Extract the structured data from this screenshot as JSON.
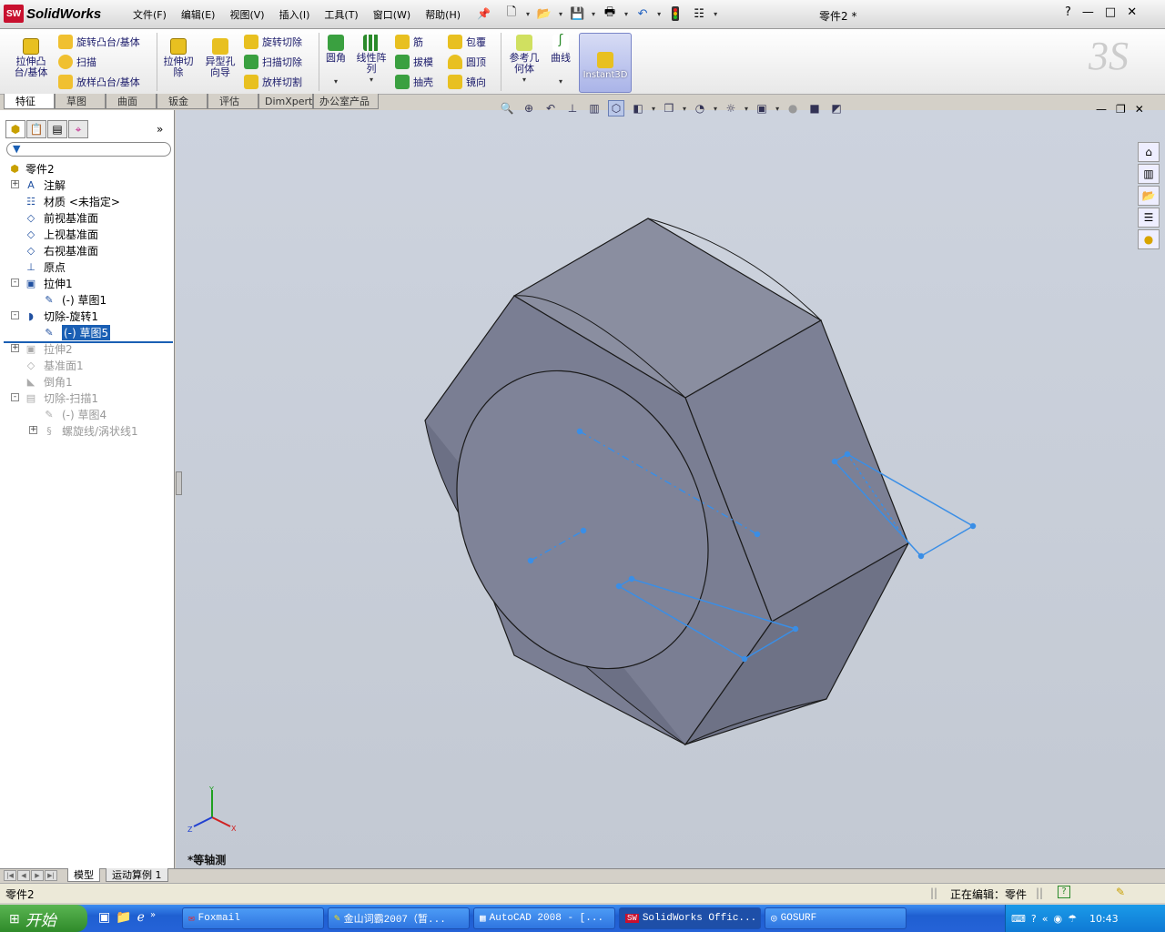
{
  "app": {
    "name": "SolidWorks",
    "document_title": "零件2 *",
    "logo_text": "SW"
  },
  "menus": [
    "文件(F)",
    "编辑(E)",
    "视图(V)",
    "插入(I)",
    "工具(T)",
    "窗口(W)",
    "帮助(H)"
  ],
  "quick_access": [
    "new-icon",
    "open-icon",
    "save-icon",
    "print-icon",
    "undo-icon",
    "rebuild-icon",
    "options-icon"
  ],
  "window_controls": [
    "?",
    "—",
    "□",
    "✕"
  ],
  "ribbon": {
    "extrude_boss": "拉伸凸\n台/基体",
    "revolve_boss": "旋转凸台/基体",
    "sweep": "扫描",
    "loft": "放样凸台/基体",
    "extrude_cut": "拉伸切\n除",
    "hole_wizard": "异型孔\n向导",
    "revolve_cut": "旋转切除",
    "sweep_cut": "扫描切除",
    "loft_cut": "放样切割",
    "fillet": "圆角",
    "linear_pattern": "线性阵\n列",
    "rib": "筋",
    "draft": "拔模",
    "shell": "抽壳",
    "wrap": "包覆",
    "dome": "圆顶",
    "mirror": "镜向",
    "ref_geometry": "参考几\n何体",
    "curves": "曲线",
    "instant3d": "Instant3D"
  },
  "command_tabs": [
    "特征",
    "草图",
    "曲面",
    "钣金",
    "评估",
    "DimXpert",
    "办公室产品"
  ],
  "tree": {
    "root": "零件2",
    "items": [
      {
        "label": "注解",
        "depth": 1,
        "expand": "+",
        "icon": "annotation-icon",
        "dim": false
      },
      {
        "label": "材质 <未指定>",
        "depth": 1,
        "expand": "",
        "icon": "material-icon",
        "dim": false
      },
      {
        "label": "前视基准面",
        "depth": 1,
        "expand": "",
        "icon": "plane-icon",
        "dim": false
      },
      {
        "label": "上视基准面",
        "depth": 1,
        "expand": "",
        "icon": "plane-icon",
        "dim": false
      },
      {
        "label": "右视基准面",
        "depth": 1,
        "expand": "",
        "icon": "plane-icon",
        "dim": false
      },
      {
        "label": "原点",
        "depth": 1,
        "expand": "",
        "icon": "origin-icon",
        "dim": false
      },
      {
        "label": "拉伸1",
        "depth": 1,
        "expand": "-",
        "icon": "extrude-icon",
        "dim": false
      },
      {
        "label": "(-) 草图1",
        "depth": 2,
        "expand": "",
        "icon": "sketch-icon",
        "dim": false
      },
      {
        "label": "切除-旋转1",
        "depth": 1,
        "expand": "-",
        "icon": "revolve-cut-icon",
        "dim": false
      },
      {
        "label": "(-) 草图5",
        "depth": 2,
        "expand": "",
        "icon": "sketch-icon",
        "dim": false,
        "selected": true
      },
      {
        "label": "拉伸2",
        "depth": 1,
        "expand": "+",
        "icon": "extrude-icon",
        "dim": true
      },
      {
        "label": "基准面1",
        "depth": 1,
        "expand": "",
        "icon": "plane-icon",
        "dim": true
      },
      {
        "label": "倒角1",
        "depth": 1,
        "expand": "",
        "icon": "chamfer-icon",
        "dim": true
      },
      {
        "label": "切除-扫描1",
        "depth": 1,
        "expand": "-",
        "icon": "sweep-cut-icon",
        "dim": true
      },
      {
        "label": "(-) 草图4",
        "depth": 2,
        "expand": "",
        "icon": "sketch-icon",
        "dim": true
      },
      {
        "label": "螺旋线/涡状线1",
        "depth": 2,
        "expand": "+",
        "icon": "helix-icon",
        "dim": true
      }
    ]
  },
  "view": {
    "label": "*等轴测",
    "axis_x": "X",
    "axis_y": "Y",
    "axis_z": "Z"
  },
  "bottom_tabs": [
    "模型",
    "运动算例 1"
  ],
  "status": {
    "left": "零件2",
    "editing": "正在编辑：零件"
  },
  "taskbar": {
    "start": "开始",
    "buttons": [
      "Foxmail",
      "金山词霸2007（暂...",
      "AutoCAD 2008 - [...",
      "SolidWorks Offic...",
      "GOSURF"
    ],
    "clock": "10:43"
  },
  "colors": {
    "sketch": "#3a8ee6",
    "model_face": "#7e8296",
    "selection": "#1a5fb4"
  }
}
